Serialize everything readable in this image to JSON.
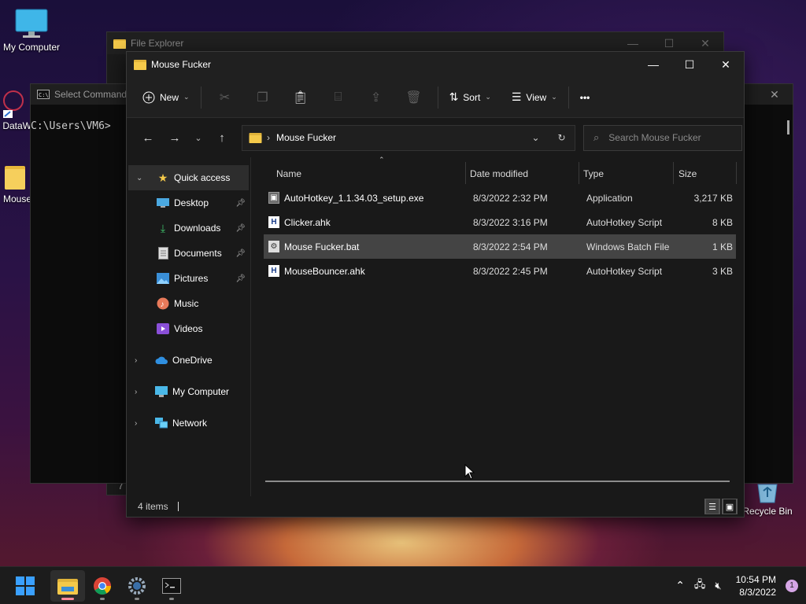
{
  "desktop": {
    "icons": [
      {
        "label": "My Computer"
      },
      {
        "label": "DataW"
      },
      {
        "label": "Mouse"
      },
      {
        "label": "Recycle Bin"
      }
    ]
  },
  "back_explorer": {
    "title": "File Explorer",
    "footer_digit": "7"
  },
  "cmd": {
    "title": "Select Command",
    "prompt": "C:\\Users\\VM6>"
  },
  "explorer": {
    "title": "Mouse Fucker",
    "toolbar": {
      "new_label": "New",
      "sort_label": "Sort",
      "view_label": "View",
      "more_label": "•••"
    },
    "address": {
      "crumb": "Mouse Fucker"
    },
    "search": {
      "placeholder": "Search Mouse Fucker"
    },
    "nav": {
      "quick_access": "Quick access",
      "items": [
        {
          "label": "Desktop",
          "icon": "desktop-icon",
          "pinned": true
        },
        {
          "label": "Downloads",
          "icon": "downloads-icon",
          "pinned": true
        },
        {
          "label": "Documents",
          "icon": "documents-icon",
          "pinned": true
        },
        {
          "label": "Pictures",
          "icon": "pictures-icon",
          "pinned": true
        },
        {
          "label": "Music",
          "icon": "music-icon",
          "pinned": false
        },
        {
          "label": "Videos",
          "icon": "videos-icon",
          "pinned": false
        }
      ],
      "onedrive": "OneDrive",
      "my_computer": "My Computer",
      "network": "Network"
    },
    "columns": {
      "name": "Name",
      "date": "Date modified",
      "type": "Type",
      "size": "Size"
    },
    "files": [
      {
        "name": "AutoHotkey_1.1.34.03_setup.exe",
        "date": "8/3/2022 2:32 PM",
        "type": "Application",
        "size": "3,217 KB",
        "selected": false
      },
      {
        "name": "Clicker.ahk",
        "date": "8/3/2022 3:16 PM",
        "type": "AutoHotkey Script",
        "size": "8 KB",
        "selected": false
      },
      {
        "name": "Mouse Fucker.bat",
        "date": "8/3/2022 2:54 PM",
        "type": "Windows Batch File",
        "size": "1 KB",
        "selected": true
      },
      {
        "name": "MouseBouncer.ahk",
        "date": "8/3/2022 2:45 PM",
        "type": "AutoHotkey Script",
        "size": "3 KB",
        "selected": false
      }
    ],
    "status": {
      "count": "4 items"
    }
  },
  "taskbar": {
    "time": "10:54 PM",
    "date": "8/3/2022",
    "notification_count": "1"
  },
  "colors": {
    "accent_selected": "#444444",
    "folder_yellow": "#f4c94a",
    "win_blue": "#3aa0ff"
  }
}
